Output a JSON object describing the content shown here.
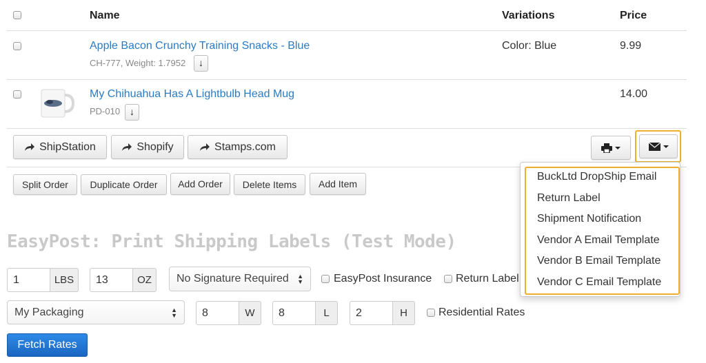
{
  "table": {
    "headers": {
      "name": "Name",
      "variations": "Variations",
      "price": "Price"
    },
    "rows": [
      {
        "name": "Apple Bacon Crunchy Training Snacks - Blue",
        "meta": "CH-777, Weight: 1.7952",
        "variation": "Color: Blue",
        "price": "9.99",
        "sort_glyph": "↓"
      },
      {
        "name": "My Chihuahua Has A Lightbulb Head Mug",
        "meta": "PD-010",
        "variation": "",
        "price": "14.00",
        "sort_glyph": "↓"
      }
    ]
  },
  "integrations": {
    "shipstation": "ShipStation",
    "shopify": "Shopify",
    "stamps": "Stamps.com"
  },
  "order_actions": {
    "split": "Split Order",
    "duplicate": "Duplicate Order",
    "add_order": "Add Order",
    "delete_items": "Delete Items",
    "add_item": "Add Item"
  },
  "email_menu": {
    "items": [
      "BuckLtd DropShip Email",
      "Return Label",
      "Shipment Notification",
      "Vendor A Email Template",
      "Vendor B Email Template",
      "Vendor C Email Template"
    ]
  },
  "easypost": {
    "title": "EasyPost: Print Shipping Labels (Test Mode)",
    "weight_lbs": {
      "value": "1",
      "unit": "LBS"
    },
    "weight_oz": {
      "value": "13",
      "unit": "OZ"
    },
    "signature": "No Signature Required",
    "insurance_label": "EasyPost Insurance",
    "return_label": "Return Label",
    "packaging": "My Packaging",
    "width": {
      "value": "8",
      "unit": "W"
    },
    "length": {
      "value": "8",
      "unit": "L"
    },
    "height": {
      "value": "2",
      "unit": "H"
    },
    "residential_label": "Residential Rates",
    "fetch_button": "Fetch Rates"
  },
  "colors": {
    "highlight": "#f0ad2e",
    "link": "#2a7bc4",
    "primary": "#1a66c2"
  }
}
